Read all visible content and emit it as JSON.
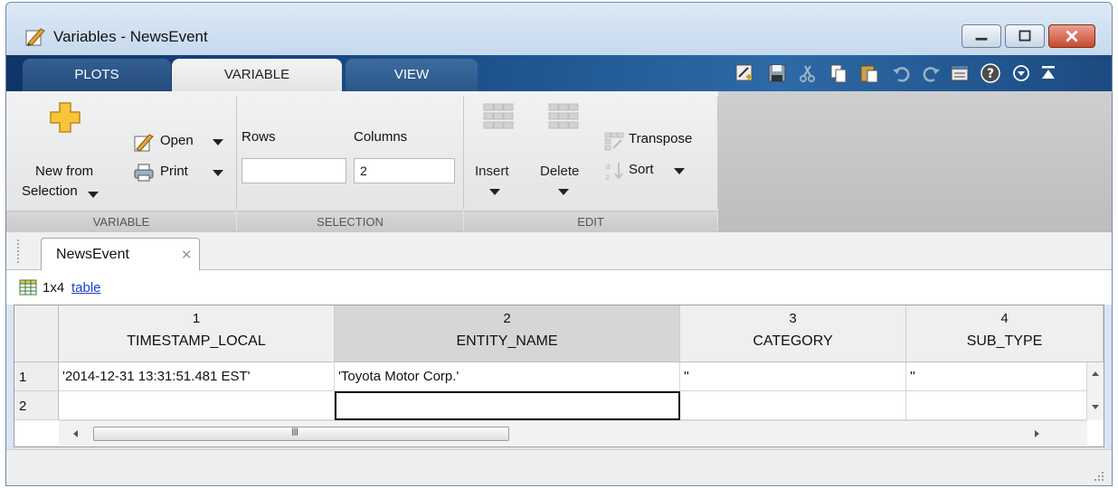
{
  "window": {
    "title": "Variables - NewsEvent",
    "accent": "#1b4f8a",
    "close_color": "#c9482f"
  },
  "tabs": [
    {
      "label": "PLOTS"
    },
    {
      "label": "VARIABLE",
      "selected": true
    },
    {
      "label": "VIEW"
    }
  ],
  "quick_access_icons": [
    "new-variable-icon",
    "save-icon",
    "cut-icon",
    "copy-icon",
    "paste-icon",
    "undo-icon",
    "redo-icon",
    "switch-windows-icon",
    "help-icon",
    "minimize-toolstrip-icon",
    "undock-icon"
  ],
  "ribbon": {
    "variable": {
      "new_from_selection_line1": "New from",
      "new_from_selection_line2": "Selection",
      "open_label": "Open",
      "print_label": "Print",
      "footer": "VARIABLE"
    },
    "selection": {
      "rows_label": "Rows",
      "columns_label": "Columns",
      "rows_value": "",
      "columns_value": "2",
      "footer": "SELECTION"
    },
    "edit": {
      "insert_label": "Insert",
      "delete_label": "Delete",
      "transpose_label": "Transpose",
      "sort_label": "Sort",
      "footer": "EDIT"
    }
  },
  "document_tab": {
    "label": "NewsEvent"
  },
  "info": {
    "dims": "1x4",
    "type_link": "table"
  },
  "table": {
    "columns": [
      {
        "num": "1",
        "name": "TIMESTAMP_LOCAL"
      },
      {
        "num": "2",
        "name": "ENTITY_NAME"
      },
      {
        "num": "3",
        "name": "CATEGORY"
      },
      {
        "num": "4",
        "name": "SUB_TYPE"
      }
    ],
    "rows": [
      {
        "num": "1",
        "cells": [
          "'2014-12-31 13:31:51.481 EST'",
          "'Toyota Motor Corp.'",
          "''",
          "''"
        ]
      },
      {
        "num": "2",
        "cells": [
          "",
          "",
          "",
          ""
        ]
      }
    ],
    "scroll_thumb_grip": "III"
  }
}
